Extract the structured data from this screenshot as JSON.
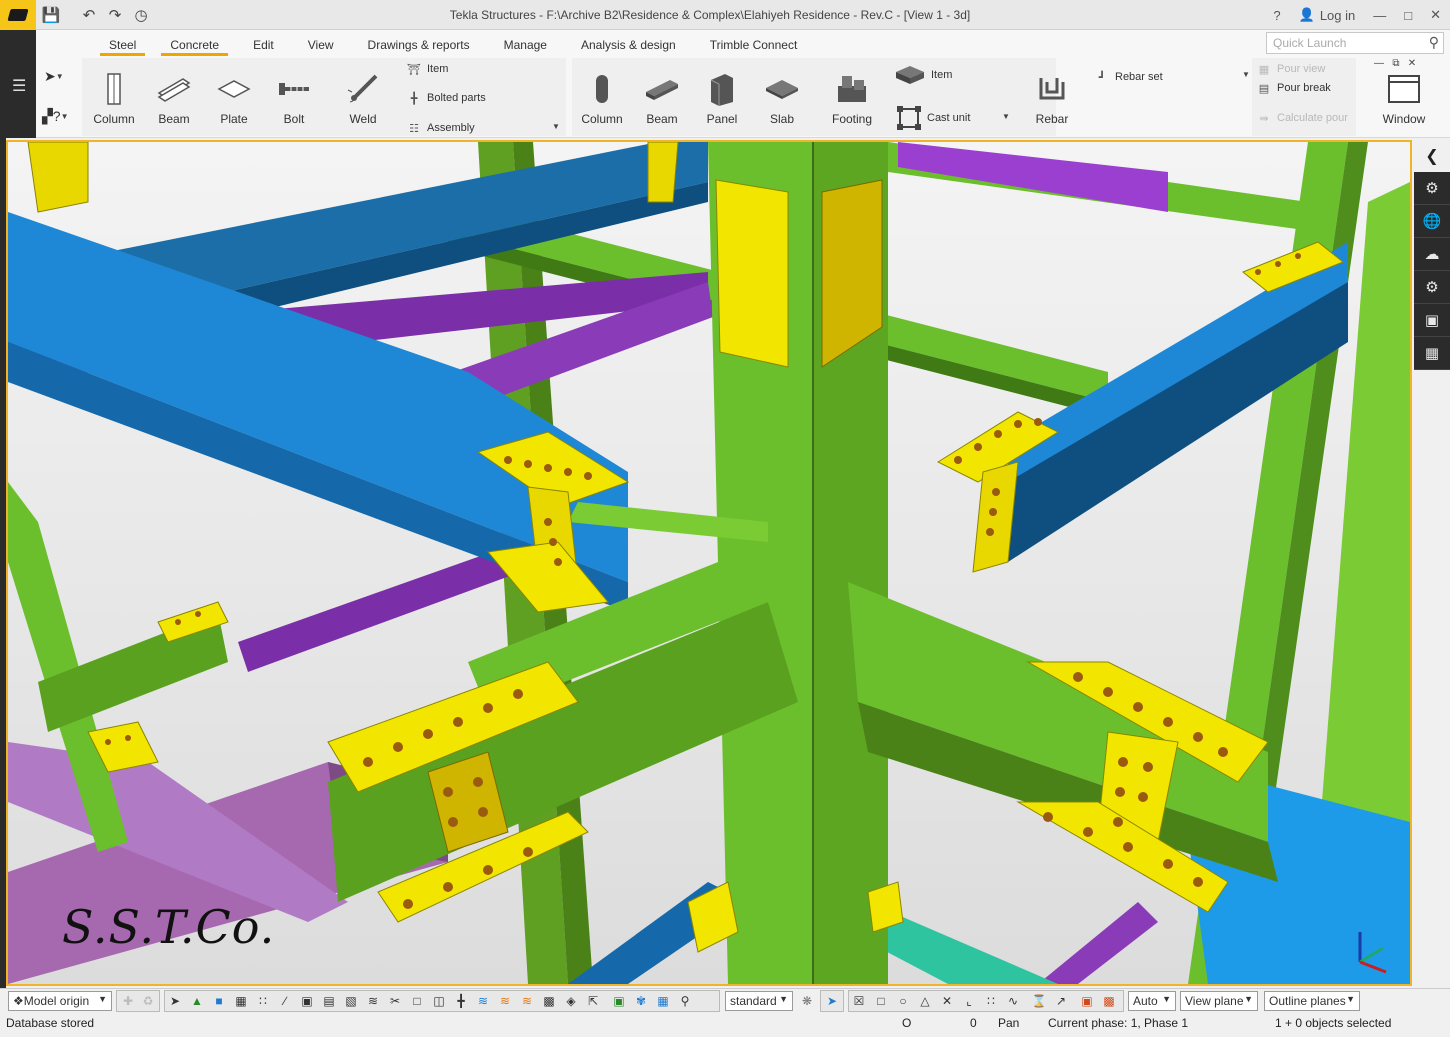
{
  "app": {
    "title": "Tekla Structures - F:\\Archive B2\\Residence & Complex\\Elahiyeh Residence - Rev.C  - [View 1 - 3d]",
    "help": "?",
    "login": "Log in"
  },
  "tabs": [
    "Steel",
    "Concrete",
    "Edit",
    "View",
    "Drawings & reports",
    "Manage",
    "Analysis & design",
    "Trimble Connect"
  ],
  "quick_launch": {
    "placeholder": "Quick Launch"
  },
  "ribbon": {
    "steel": {
      "column": "Column",
      "beam": "Beam",
      "plate": "Plate",
      "bolt": "Bolt",
      "weld": "Weld",
      "item": "Item",
      "bolted_parts": "Bolted parts",
      "assembly": "Assembly"
    },
    "concrete": {
      "column": "Column",
      "beam": "Beam",
      "panel": "Panel",
      "slab": "Slab",
      "footing": "Footing",
      "item": "Item",
      "cast_unit": "Cast unit",
      "rebar": "Rebar",
      "rebar_set": "Rebar set"
    },
    "pour": {
      "pour_view": "Pour view",
      "pour_break": "Pour break",
      "calculate_pour": "Calculate pour"
    },
    "window": "Window"
  },
  "viewport": {
    "watermark": "S.S.T.Co."
  },
  "bottom_toolbar": {
    "model_origin": "Model origin",
    "standard": "standard",
    "auto": "Auto",
    "view_plane": "View plane",
    "outline_planes": "Outline planes"
  },
  "status": {
    "message": "Database stored",
    "o_label": "O",
    "coord": "0",
    "mode": "Pan",
    "phase": "Current phase: 1, Phase 1",
    "selection": "1 + 0 objects selected"
  },
  "colors": {
    "accent": "#f0a500",
    "green_member": "#6cbf2c",
    "blue_member": "#1e88d6",
    "purple_member": "#7a2fa8",
    "plate": "#f2e600"
  }
}
